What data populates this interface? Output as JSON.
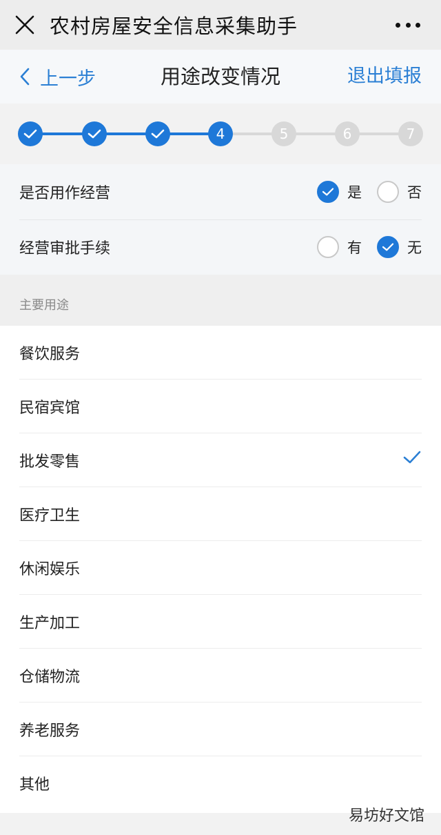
{
  "appbar": {
    "title": "农村房屋安全信息采集助手"
  },
  "navbar": {
    "back_label": "上一步",
    "page_title": "用途改变情况",
    "exit_label": "退出填报"
  },
  "stepper": {
    "current_step": 4,
    "steps": [
      "1",
      "2",
      "3",
      "4",
      "5",
      "6",
      "7"
    ],
    "accent_color": "#1e78d8",
    "inactive_color": "#d8d8d8"
  },
  "questions": [
    {
      "label": "是否用作经营",
      "options": [
        "是",
        "否"
      ],
      "selected": "是"
    },
    {
      "label": "经营审批手续",
      "options": [
        "有",
        "无"
      ],
      "selected": "无"
    }
  ],
  "usage_section": {
    "header": "主要用途",
    "items": [
      "餐饮服务",
      "民宿宾馆",
      "批发零售",
      "医疗卫生",
      "休闲娱乐",
      "生产加工",
      "仓储物流",
      "养老服务",
      "其他"
    ],
    "selected": "批发零售"
  },
  "watermark": "易坊好文馆"
}
